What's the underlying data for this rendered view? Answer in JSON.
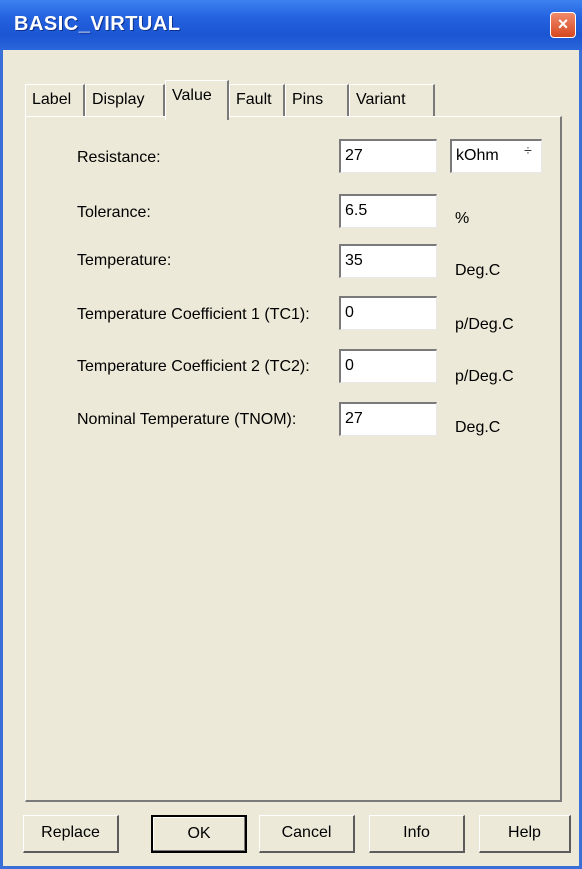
{
  "window": {
    "title": "BASIC_VIRTUAL",
    "close_icon": "×"
  },
  "tabs": [
    {
      "label": "Label"
    },
    {
      "label": "Display"
    },
    {
      "label": "Value",
      "active": true
    },
    {
      "label": "Fault"
    },
    {
      "label": "Pins"
    },
    {
      "label": "Variant"
    }
  ],
  "fields": [
    {
      "label": "Resistance:",
      "value": "27",
      "unit": "kOhm"
    },
    {
      "label": "Tolerance:",
      "value": "6.5",
      "unit": "%"
    },
    {
      "label": "Temperature:",
      "value": "35",
      "unit": "Deg.C"
    },
    {
      "label": "Temperature Coefficient 1 (TC1):",
      "value": "0",
      "unit": "p/Deg.C"
    },
    {
      "label": "Temperature Coefficient 2 (TC2):",
      "value": "0",
      "unit": "p/Deg.C"
    },
    {
      "label": "Nominal Temperature (TNOM):",
      "value": "27",
      "unit": "Deg.C"
    }
  ],
  "spinner_icon": "÷",
  "buttons": {
    "replace": "Replace",
    "ok": "OK",
    "cancel": "Cancel",
    "info": "Info",
    "help": "Help"
  },
  "colors": {
    "titlebar": "#2462e0",
    "dialog_bg": "#ece9d8",
    "close_button": "#d6481f"
  }
}
